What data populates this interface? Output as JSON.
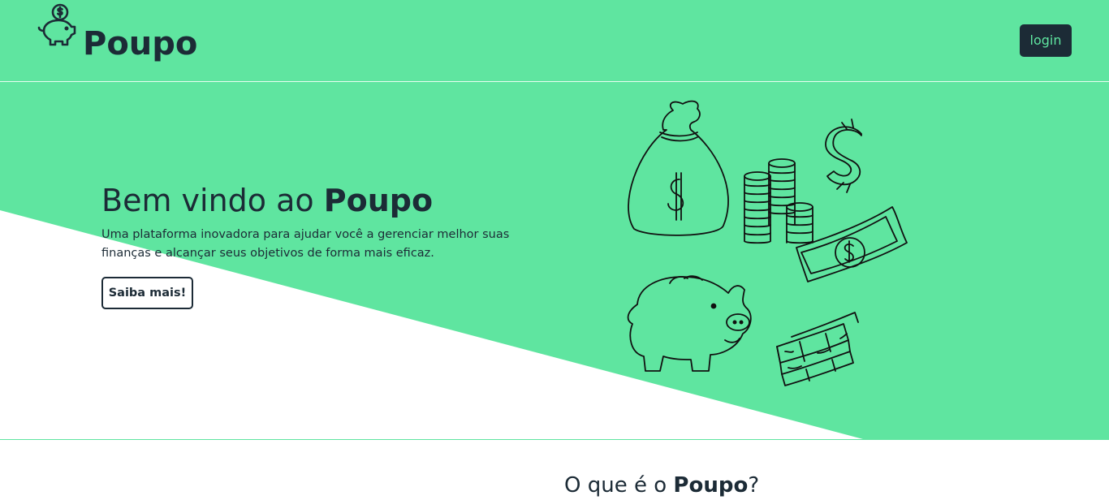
{
  "header": {
    "brand_name": "Poupo",
    "logo_icon": "piggy-bank-dollar-icon",
    "login_label": "login",
    "background": "#5fe5a0"
  },
  "hero": {
    "title_prefix": "Bem vindo ao ",
    "title_brand": "Poupo",
    "description": "Uma plataforma inovadora para ajudar você a gerenciar melhor suas finanças e alcançar seus objetivos de forma mais eficaz.",
    "cta_label": "Saiba mais!",
    "illustration_items": [
      "money-bag-icon",
      "coin-stack-icon",
      "dollar-sign-icon",
      "banknote-icon",
      "piggy-bank-icon",
      "cash-bundle-icon"
    ]
  },
  "about": {
    "title_prefix": "O que é o ",
    "title_brand": "Poupo",
    "title_suffix": "?"
  },
  "colors": {
    "accent": "#5fe5a0",
    "dark": "#1c2b36",
    "white": "#ffffff"
  }
}
